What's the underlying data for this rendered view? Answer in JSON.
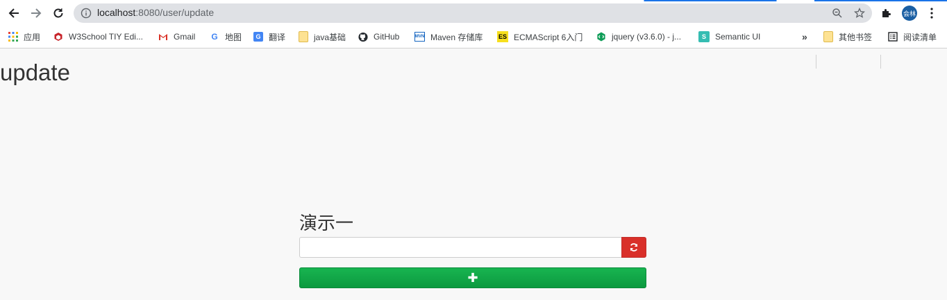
{
  "browser": {
    "url_host": "localhost",
    "url_path": ":8080/user/update",
    "avatar_text": "会林"
  },
  "bookmarks": [
    {
      "label": "应用",
      "icon": "apps-grid-icon"
    },
    {
      "label": "W3School TIY Edi...",
      "icon": "w3school-icon"
    },
    {
      "label": "Gmail",
      "icon": "gmail-icon"
    },
    {
      "label": "地图",
      "icon": "google-icon"
    },
    {
      "label": "翻译",
      "icon": "translate-icon"
    },
    {
      "label": "java基础",
      "icon": "folder-icon"
    },
    {
      "label": "GitHub",
      "icon": "github-icon"
    },
    {
      "label": "Maven 存储库",
      "icon": "maven-icon"
    },
    {
      "label": "ECMAScript 6入门",
      "icon": "es-icon"
    },
    {
      "label": "jquery (v3.6.0) - j...",
      "icon": "jquery-icon"
    },
    {
      "label": "Semantic UI",
      "icon": "semantic-ui-icon"
    },
    {
      "label": "»",
      "icon": "more-bookmarks-icon"
    },
    {
      "label": "其他书签",
      "icon": "folder-icon"
    },
    {
      "label": "阅读清单",
      "icon": "reading-list-icon"
    }
  ],
  "page": {
    "title": "update",
    "demo_title": "演示一",
    "input_value": "",
    "add_symbol": "✚"
  },
  "colors": {
    "refresh_button": "#d9302a",
    "add_button": "#0c9a40",
    "loading_bar": "#1a73e8"
  }
}
